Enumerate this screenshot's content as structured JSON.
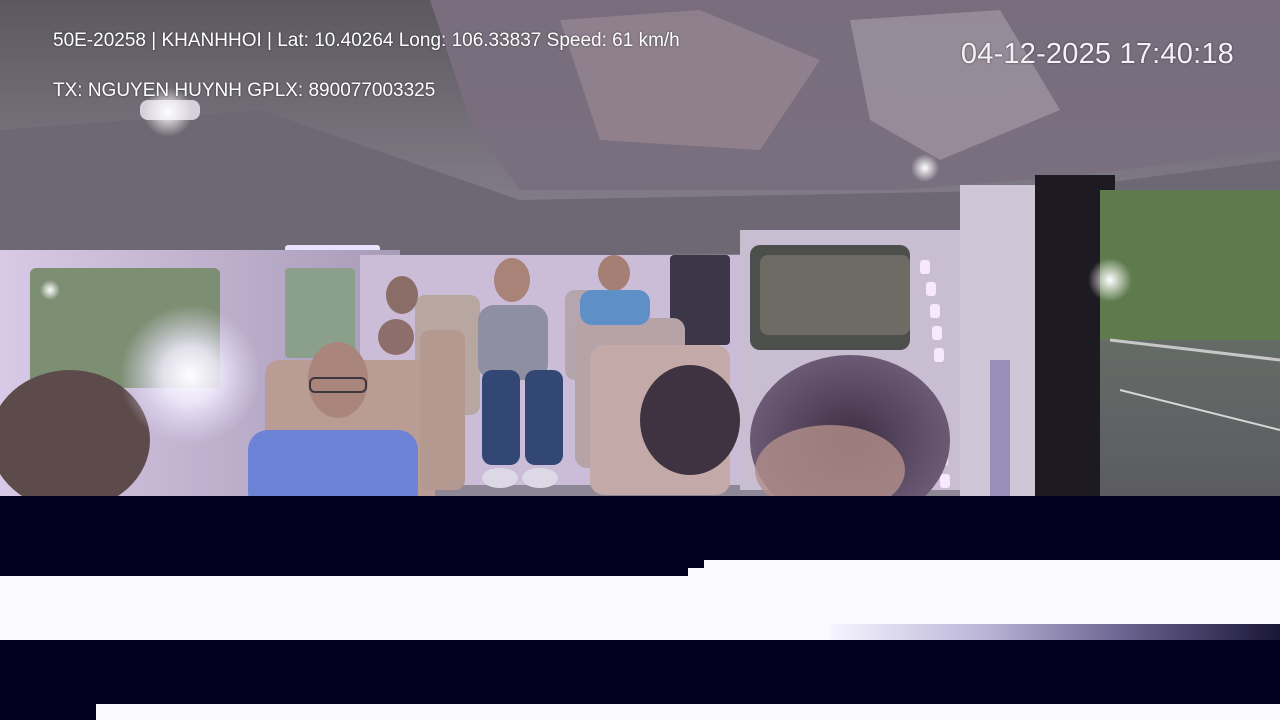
{
  "overlay": {
    "vehicle_info": "50E-20258 | KHANHHOI | Lat: 10.40264 Long: 106.33837 Speed: 61 km/h",
    "driver_info": "TX: NGUYEN HUYNH GPLX: 890077003325",
    "datetime": "04-12-2025 17:40:18"
  },
  "colors": {
    "overlay_text": "#ffffff",
    "glitch_dark": "#02011e",
    "glitch_light": "#fbfaff",
    "cabin_lavender": "#b9a9c9"
  }
}
